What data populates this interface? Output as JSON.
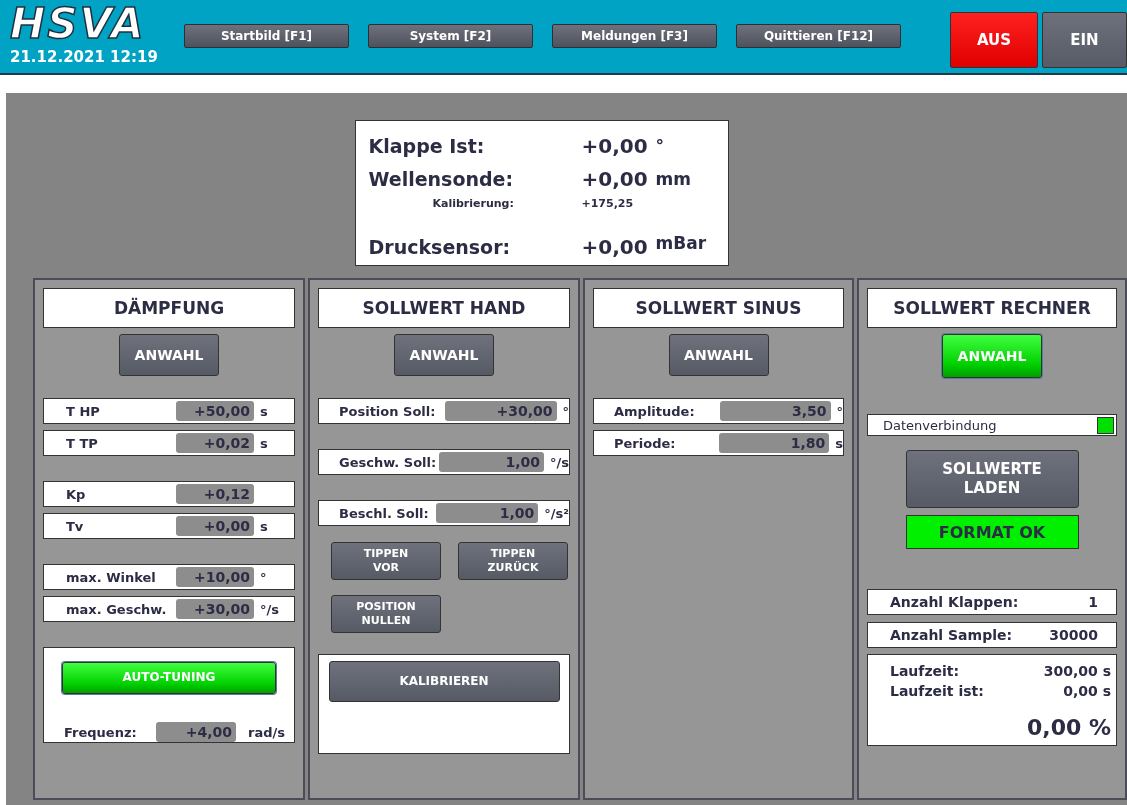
{
  "header": {
    "logo": "HSVA",
    "datetime": "21.12.2021 12:19",
    "nav_buttons": [
      "Startbild [F1]",
      "System [F2]",
      "Meldungen [F3]",
      "Quittieren [F12]"
    ],
    "power_buttons": [
      {
        "label": "AUS",
        "active": true
      },
      {
        "label": "EIN",
        "active": false
      }
    ]
  },
  "readouts": [
    {
      "label": "Klappe Ist:",
      "value": "+0,00",
      "unit": "°"
    },
    {
      "label": "Wellensonde:",
      "value": "+0,00",
      "unit": "mm",
      "sub": {
        "label": "Kalibrierung:",
        "value": "+175,25"
      }
    },
    {
      "label": "Drucksensor:",
      "value": "+0,00",
      "unit": "mBar"
    }
  ],
  "panels": [
    {
      "title": "DÄMPFUNG",
      "select_button": {
        "label": "ANWAHL",
        "active": false
      },
      "groups": [
        [
          {
            "label": "T HP",
            "value": "+50,00",
            "unit": "s"
          },
          {
            "label": "T TP",
            "value": "+0,02",
            "unit": "s"
          }
        ],
        [
          {
            "label": "Kp",
            "value": "+0,12"
          },
          {
            "label": "Tv",
            "value": "+0,00",
            "unit": "s"
          }
        ],
        [
          {
            "label": "max. Winkel",
            "value": "+10,00",
            "unit": "°"
          },
          {
            "label": "max. Geschw.",
            "value": "+30,00",
            "unit": "°/s"
          }
        ]
      ],
      "tuning": {
        "button": {
          "label": "AUTO-TUNING",
          "active": true
        },
        "field": {
          "label": "Frequenz:",
          "value": "+4,00",
          "unit": "rad/s"
        }
      }
    },
    {
      "title": "SOLLWERT HAND",
      "select_button": {
        "label": "ANWAHL",
        "active": false
      },
      "groups": [
        [
          {
            "label": "Position Soll:",
            "value": "+30,00",
            "unit": "°"
          }
        ],
        [
          {
            "label": "Geschw. Soll:",
            "value": "1,00",
            "unit": "°/s"
          }
        ],
        [
          {
            "label": "Beschl. Soll:",
            "value": "1,00",
            "unit": "°/s²"
          }
        ]
      ],
      "jog_buttons": [
        [
          "TIPPEN\nVOR",
          "TIPPEN\nZURÜCK"
        ],
        [
          "POSITION\nNULLEN"
        ]
      ],
      "calibrate_button": "KALIBRIEREN"
    },
    {
      "title": "SOLLWERT SINUS",
      "select_button": {
        "label": "ANWAHL",
        "active": false
      },
      "groups": [
        [
          {
            "label": "Amplitude:",
            "value": "3,50",
            "unit": "°"
          },
          {
            "label": "Periode:",
            "value": "1,80",
            "unit": "s"
          }
        ]
      ]
    },
    {
      "title": "SOLLWERT RECHNER",
      "select_button": {
        "label": "ANWAHL",
        "active": true
      },
      "connection": {
        "label": "Datenverbindung",
        "on": true
      },
      "load_button": "SOLLWERTE\nLADEN",
      "format_status": {
        "label": "FORMAT OK",
        "ok": true
      },
      "counts": [
        {
          "label": "Anzahl Klappen:",
          "value": "1"
        },
        {
          "label": "Anzahl Sample:",
          "value": "30000"
        }
      ],
      "runtime": {
        "rows": [
          {
            "label": "Laufzeit:",
            "value": "300,00 s"
          },
          {
            "label": "Laufzeit ist:",
            "value": "0,00 s"
          }
        ],
        "percent": "0,00 %"
      }
    }
  ]
}
